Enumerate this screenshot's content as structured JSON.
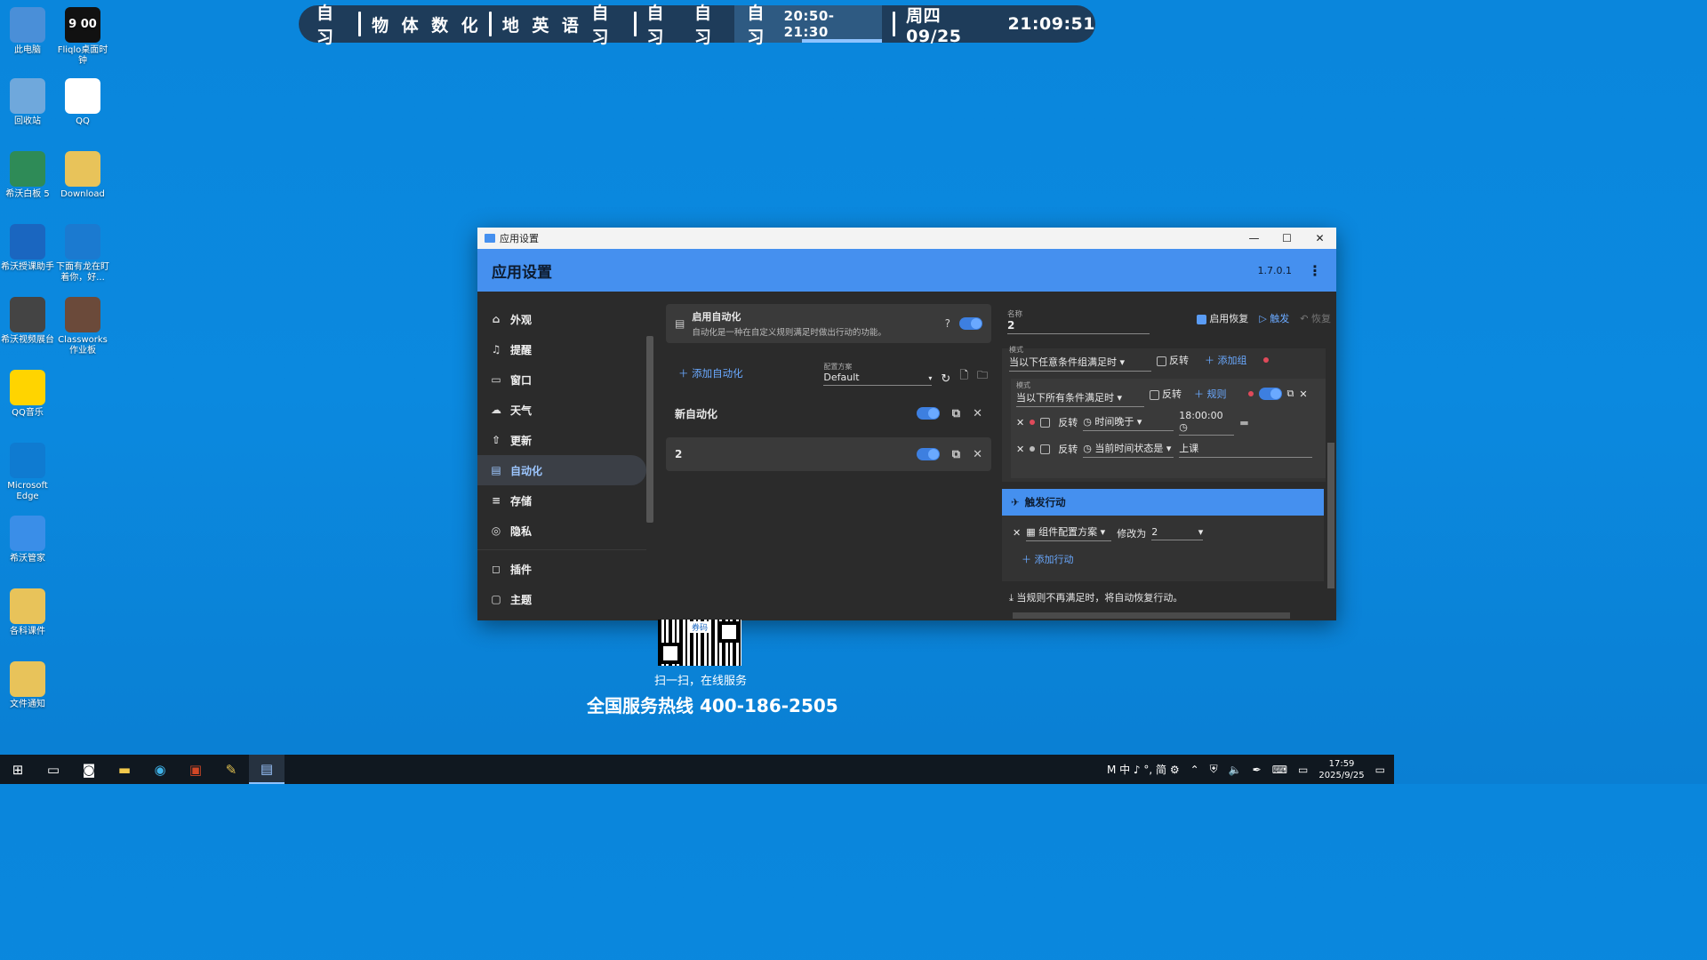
{
  "desktop_icons": [
    {
      "label": "此电脑",
      "icon": "computer-icon",
      "bg": "#4a8fd8"
    },
    {
      "label": "Fliqlo桌面时钟",
      "icon": "clock-icon",
      "bg": "#111"
    },
    {
      "label": "回收站",
      "icon": "recycle-bin-icon",
      "bg": "#6fa8dc"
    },
    {
      "label": "QQ",
      "icon": "qq-icon",
      "bg": "#fff"
    },
    {
      "label": "希沃白板 5",
      "icon": "whiteboard-icon",
      "bg": "#2e8b57"
    },
    {
      "label": "Download",
      "icon": "folder-icon",
      "bg": "#e8c35a"
    },
    {
      "label": "希沃授课助手",
      "icon": "link-icon",
      "bg": "#1a66c0"
    },
    {
      "label": "下面有龙在盯着你，好...",
      "icon": "peek-icon",
      "bg": "#1b7ad0"
    },
    {
      "label": "希沃视频展台",
      "icon": "camera-icon",
      "bg": "#444"
    },
    {
      "label": "Classworks作业板",
      "icon": "classworks-icon",
      "bg": "#6b4a3a"
    },
    {
      "label": "QQ音乐",
      "icon": "qq-music-icon",
      "bg": "#ffd400"
    },
    {
      "label": "Microsoft Edge",
      "icon": "edge-icon",
      "bg": "#0f7bd1"
    },
    {
      "label": "希沃管家",
      "icon": "shield-icon",
      "bg": "#3a8ee8"
    },
    {
      "label": "各科课件",
      "icon": "folder-icon",
      "bg": "#e8c35a"
    },
    {
      "label": "文件通知",
      "icon": "warning-folder-icon",
      "bg": "#e8c35a"
    }
  ],
  "clock_icon_text": "9 00",
  "schedule": {
    "items": [
      "自习",
      "物",
      "体",
      "数",
      "化",
      "地",
      "英",
      "语",
      "自习",
      "自习",
      "自习"
    ],
    "current": "自习",
    "current_time": "20:50-21:30",
    "date": "周四 09/25",
    "time": "21:09:51"
  },
  "window": {
    "titlebar": "应用设置",
    "header_title": "应用设置",
    "version": "1.7.0.1",
    "sidebar": [
      {
        "label": "外观",
        "icon": "appearance-icon"
      },
      {
        "label": "提醒",
        "icon": "bell-icon"
      },
      {
        "label": "窗口",
        "icon": "window-icon"
      },
      {
        "label": "天气",
        "icon": "cloud-icon"
      },
      {
        "label": "更新",
        "icon": "upload-icon"
      },
      {
        "label": "自动化",
        "icon": "automation-icon",
        "active": true
      },
      {
        "label": "存储",
        "icon": "database-icon"
      },
      {
        "label": "隐私",
        "icon": "privacy-icon"
      },
      {
        "label": "插件",
        "icon": "plugin-icon"
      },
      {
        "label": "主题",
        "icon": "theme-icon"
      }
    ],
    "enable_title": "启用自动化",
    "enable_desc": "自动化是一种在自定义规则满足时做出行动的功能。",
    "add_automation": "添加自动化",
    "config_label": "配置方案",
    "config_value": "Default",
    "automations": [
      {
        "name": "新自动化"
      },
      {
        "name": "2"
      }
    ],
    "right": {
      "name_label": "名称",
      "name_value": "2",
      "enable_restore": "启用恢复",
      "trigger": "触发",
      "restore": "恢复",
      "mode_label": "模式",
      "group_mode": "当以下任意条件组满足时",
      "invert": "反转",
      "add_group": "添加组",
      "sub_mode": "当以下所有条件满足时",
      "rule": "规则",
      "rule1_cond": "时间晚于",
      "rule1_value": "18:00:00",
      "rule2_cond": "当前时间状态是",
      "rule2_value": "上课",
      "trigger_actions": "触发行动",
      "action_name": "组件配置方案",
      "action_op": "修改为",
      "action_value": "2",
      "add_action": "添加行动",
      "restore_note": "当规则不再满足时，将自动恢复行动。"
    }
  },
  "ad": {
    "qr_badge": "券码",
    "scan_text": "扫一扫，在线服务",
    "hotline": "全国服务热线 400-186-2505"
  },
  "taskbar": {
    "ime": "M 中 ♪ °, 简 ⚙",
    "time": "17:59",
    "date": "2025/9/25"
  }
}
